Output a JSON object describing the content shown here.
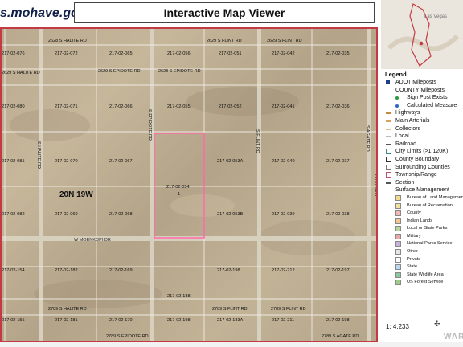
{
  "header": {
    "logo": "s.mohave.gov",
    "title": "Interactive Map Viewer"
  },
  "inset": {
    "city_label": "Las Vegas"
  },
  "map": {
    "township_label": "20N 19W",
    "parcels": [
      "217-02-076",
      "217-02-072",
      "217-02-065",
      "217-02-056",
      "217-02-051",
      "217-02-042",
      "217-02-035",
      "217-02-080",
      "217-02-071",
      "217-02-066",
      "217-02-055",
      "217-02-052",
      "217-02-041",
      "217-02-036",
      "217-02-081",
      "217-02-070",
      "217-02-067",
      "217-02-053A",
      "217-02-040",
      "217-02-037",
      "217-02-082",
      "217-02-069",
      "217-02-068",
      "217-02-053B",
      "217-02-039",
      "217-02-038",
      "217-02-154",
      "217-02-182",
      "217-02-169",
      "217-02-212",
      "217-02-197",
      "217-02-188",
      "217-02-198",
      "217-02-211",
      "217-02-198",
      "217-02-155",
      "217-02-181",
      "217-02-170",
      "217-02-183A",
      "217-02-198"
    ],
    "subject_parcel": "217-02-054",
    "subject_parcel_note": "1",
    "roads": {
      "halite_rd_top": "2628 S HALITE RD",
      "flint_rd_top": "2629 S FLINT RD",
      "flint_rd_top2": "2629 S FLINT RD",
      "halite_rd_left": "2629 S HALITE RD",
      "epidote_rd_top": "2629 S EPIDOTE RD",
      "epidote_rd_top2": "2628 S EPIDOTE RD",
      "halite_v": "S HALITE RD",
      "epidote_v": "S EPIDOTE RD",
      "flint_v": "S FLINT RD",
      "agate_v": "S AGATE RD",
      "moenkopi": "W MOENKOPI DR",
      "halite_rd_bottom": "2789 S HALITE RD",
      "flint_rd_bottom": "2789 S FLINT RD",
      "flint_rd_bottom2": "2789 S FLINT RD",
      "epidote_rd_bottom": "2789 S EPIDOTE RD",
      "agate_rd_bottom": "2789 S AGATE RD",
      "side_code_right": "217-02-006"
    }
  },
  "legend": {
    "title": "Legend",
    "items": [
      {
        "label": "ADOT Mileposts",
        "color": "#1f3f8c"
      },
      {
        "label": "COUNTY Mileposts",
        "color": ""
      },
      {
        "label": "Sign Post Exists",
        "color": "#2c9a3a"
      },
      {
        "label": "Calculated Measure",
        "color": "#2f66c0"
      },
      {
        "label": "Highways",
        "color": "#c58a3a"
      },
      {
        "label": "Main Arterials",
        "color": "#d9a25a"
      },
      {
        "label": "Collectors",
        "color": "#e6c08a"
      },
      {
        "label": "Local",
        "color": "#bbbbbb"
      },
      {
        "label": "Railroad",
        "color": "#555555"
      },
      {
        "label": "City Limits (>1:120K)",
        "color": "#3a8a8a"
      },
      {
        "label": "County Boundary",
        "color": "#333333"
      },
      {
        "label": "Surrounding Counties",
        "color": "#777777"
      },
      {
        "label": "Township/Range",
        "color": "#c0506a"
      },
      {
        "label": "Section",
        "color": "#555555"
      },
      {
        "label": "Surface Management",
        "color": ""
      },
      {
        "label": "Bureau of Land Management",
        "color": "#f5dc8f"
      },
      {
        "label": "Bureau of Reclamation",
        "color": "#f4e3a0"
      },
      {
        "label": "County",
        "color": "#f0b8b0"
      },
      {
        "label": "Indian Lands",
        "color": "#f2c690"
      },
      {
        "label": "Local or State Parks",
        "color": "#b9d6a0"
      },
      {
        "label": "Military",
        "color": "#e9a9a9"
      },
      {
        "label": "National Parks Service",
        "color": "#c9b4e0"
      },
      {
        "label": "Other",
        "color": "#e6e6e6"
      },
      {
        "label": "Private",
        "color": "#ffffff"
      },
      {
        "label": "State",
        "color": "#b9d8f2"
      },
      {
        "label": "State Wildlife Area",
        "color": "#8fc8a0"
      },
      {
        "label": "US Forest Service",
        "color": "#9ccc88"
      }
    ]
  },
  "scale": "1: 4,233",
  "watermark": "WAR"
}
